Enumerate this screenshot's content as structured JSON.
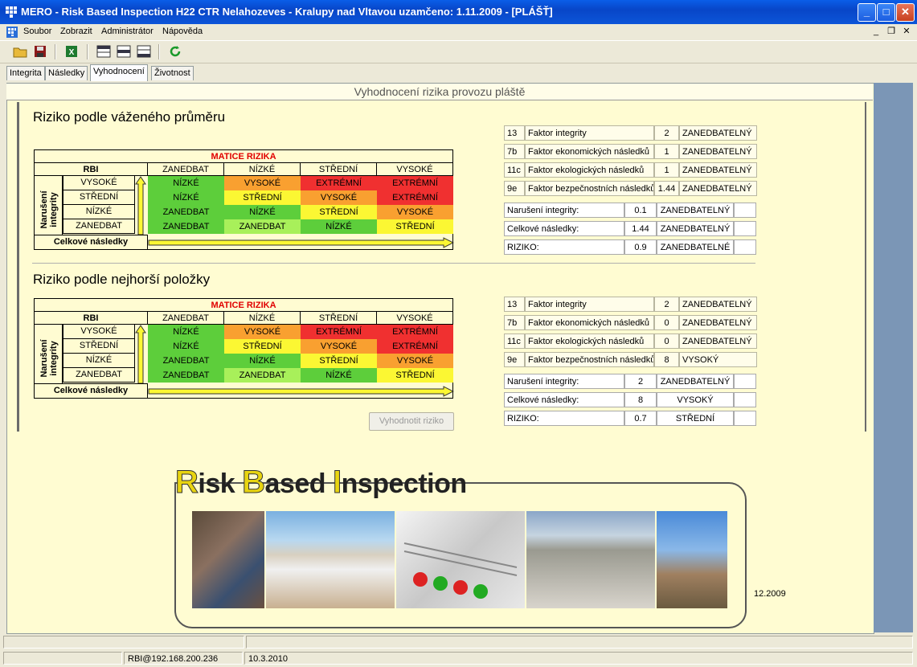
{
  "window": {
    "title": "MERO - Risk Based Inspection H22 CTR Nelahozeves - Kralupy nad Vltavou uzamčeno:  1.11.2009 - [PLÁŠŤ]"
  },
  "menu": {
    "items": [
      "Soubor",
      "Zobrazit",
      "Administrátor",
      "Nápověda"
    ]
  },
  "toolbar": {
    "icons": [
      "open-folder-icon",
      "save-icon",
      "excel-icon",
      "layout-top-icon",
      "layout-middle-icon",
      "layout-bottom-icon",
      "refresh-icon"
    ]
  },
  "tabs": [
    {
      "label": "Integrita"
    },
    {
      "label": "Následky"
    },
    {
      "label": "Vyhodnocení",
      "active": true
    },
    {
      "label": "Životnost"
    }
  ],
  "page": {
    "heading": "Vyhodnocení rizika provozu pláště"
  },
  "matrix": {
    "title": "MATICE RIZIKA",
    "rbi": "RBI",
    "row_axis": "Narušení integrity",
    "col_axis": "Celkové následky",
    "col_headers": [
      "ZANEDBAT",
      "NÍZKÉ",
      "STŘEDNÍ",
      "VYSOKÉ"
    ],
    "row_headers": [
      "VYSOKÉ",
      "STŘEDNÍ",
      "NÍZKÉ",
      "ZANEDBAT"
    ],
    "cells": [
      [
        "NÍZKÉ",
        "VYSOKÉ",
        "EXTRÉMNÍ",
        "EXTRÉMNÍ"
      ],
      [
        "NÍZKÉ",
        "STŘEDNÍ",
        "VYSOKÉ",
        "EXTRÉMNÍ"
      ],
      [
        "ZANEDBAT",
        "NÍZKÉ",
        "STŘEDNÍ",
        "VYSOKÉ"
      ],
      [
        "ZANEDBAT",
        "ZANEDBAT",
        "NÍZKÉ",
        "STŘEDNÍ"
      ]
    ],
    "colors": {
      "green": "#5dce3b",
      "orange": "#f9a030",
      "red": "#f03030",
      "yellow": "#fbf733",
      "lightgreen": "#a8f05a"
    }
  },
  "section1": {
    "title": "Riziko podle váženého průměru",
    "factors": [
      {
        "code": "13",
        "name": "Faktor integrity",
        "value": "2",
        "level": "ZANEDBATELNÝ"
      },
      {
        "code": "7b",
        "name": "Faktor ekonomických následků",
        "value": "1",
        "level": "ZANEDBATELNÝ"
      },
      {
        "code": "11c",
        "name": "Faktor ekologických následků",
        "value": "1",
        "level": "ZANEDBATELNÝ"
      },
      {
        "code": "9e",
        "name": "Faktor bezpečnostních následků",
        "value": "1.44",
        "level": "ZANEDBATELNÝ"
      }
    ],
    "summary": [
      {
        "label": "Narušení integrity:",
        "value": "0.1",
        "level": "ZANEDBATELNÝ"
      },
      {
        "label": "Celkové následky:",
        "value": "1.44",
        "level": "ZANEDBATELNÝ"
      },
      {
        "label": "RIZIKO:",
        "value": "0.9",
        "level": "ZANEDBATELNÉ"
      }
    ]
  },
  "section2": {
    "title": "Riziko podle nejhorší položky",
    "factors": [
      {
        "code": "13",
        "name": "Faktor integrity",
        "value": "2",
        "level": "ZANEDBATELNÝ"
      },
      {
        "code": "7b",
        "name": "Faktor ekonomických následků",
        "value": "0",
        "level": "ZANEDBATELNÝ"
      },
      {
        "code": "11c",
        "name": "Faktor ekologických následků",
        "value": "0",
        "level": "ZANEDBATELNÝ"
      },
      {
        "code": "9e",
        "name": "Faktor bezpečnostních následků",
        "value": "8",
        "level": "VYSOKÝ"
      }
    ],
    "summary": [
      {
        "label": "Narušení integrity:",
        "value": "2",
        "level": "ZANEDBATELNÝ"
      },
      {
        "label": "Celkové následky:",
        "value": "8",
        "level": "VYSOKÝ"
      },
      {
        "label": "RIZIKO:",
        "value": "0.7",
        "level": "STŘEDNÍ"
      }
    ],
    "button": "Vyhodnotit riziko"
  },
  "banner": {
    "title": "Risk Based Inspection",
    "date": "12.2009"
  },
  "statusbar": {
    "connection": "RBI@192.168.200.236",
    "date": "10.3.2010"
  }
}
